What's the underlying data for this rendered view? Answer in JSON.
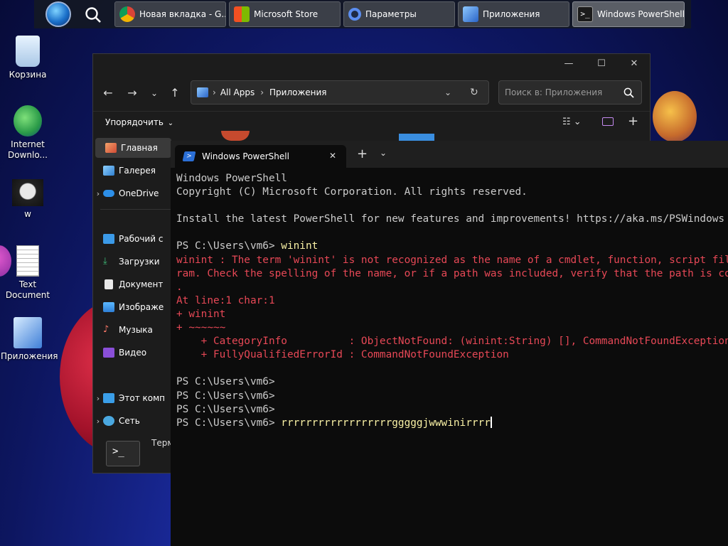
{
  "taskbar": {
    "items": [
      {
        "label": "Новая вкладка - G...",
        "icon": "chrome-icon"
      },
      {
        "label": "Microsoft Store",
        "icon": "store-icon"
      },
      {
        "label": "Параметры",
        "icon": "settings-icon"
      },
      {
        "label": "Приложения",
        "icon": "control-panel-icon"
      },
      {
        "label": "Windows PowerShell",
        "icon": "powershell-icon",
        "active": true
      }
    ]
  },
  "desktop": {
    "icons": [
      {
        "label": "Корзина",
        "icon": "recycle-bin-icon"
      },
      {
        "label": "Internet Downlo...",
        "icon": "idm-icon"
      },
      {
        "label": "w",
        "icon": "face-image-icon"
      },
      {
        "label": "Text Document",
        "icon": "text-document-icon"
      },
      {
        "label": "Приложения",
        "icon": "control-panel-icon"
      }
    ]
  },
  "explorer": {
    "breadcrumb": [
      "All Apps",
      "Приложения"
    ],
    "search_placeholder": "Поиск в: Приложения",
    "sort_label": "Упорядочить",
    "sidebar": [
      {
        "label": "Главная",
        "icon": "home-icon",
        "selected": true
      },
      {
        "label": "Галерея",
        "icon": "gallery-icon"
      },
      {
        "label": "OneDrive",
        "icon": "cloud-icon",
        "expandable": true
      },
      {
        "label": "Рабочий с",
        "icon": "desktop-icon"
      },
      {
        "label": "Загрузки",
        "icon": "download-icon"
      },
      {
        "label": "Документ",
        "icon": "document-icon"
      },
      {
        "label": "Изображе",
        "icon": "image-icon"
      },
      {
        "label": "Музыка",
        "icon": "music-icon"
      },
      {
        "label": "Видео",
        "icon": "video-icon"
      },
      {
        "label": "Этот комп",
        "icon": "computer-icon",
        "expandable": true
      },
      {
        "label": "Сеть",
        "icon": "network-icon",
        "expandable": true
      }
    ],
    "bottom_item": "Терм"
  },
  "powershell": {
    "tab_title": "Windows PowerShell",
    "lines": [
      {
        "text": "Windows PowerShell",
        "style": "normal"
      },
      {
        "text": "Copyright (C) Microsoft Corporation. All rights reserved.",
        "style": "normal"
      },
      {
        "text": "",
        "style": "normal"
      },
      {
        "text": "Install the latest PowerShell for new features and improvements! https://aka.ms/PSWindows",
        "style": "normal"
      },
      {
        "text": "",
        "style": "normal"
      },
      {
        "prompt": "PS C:\\Users\\vm6> ",
        "command": "winint",
        "style": "prompt"
      },
      {
        "text": "winint : The term 'winint' is not recognized as the name of a cmdlet, function, script file, or operable prog",
        "style": "error"
      },
      {
        "text": "ram. Check the spelling of the name, or if a path was included, verify that the path is correct and try again.",
        "style": "error"
      },
      {
        "text": ".",
        "style": "error"
      },
      {
        "text": "At line:1 char:1",
        "style": "error"
      },
      {
        "text": "+ winint",
        "style": "error"
      },
      {
        "text": "+ ~~~~~~",
        "style": "error"
      },
      {
        "text": "    + CategoryInfo          : ObjectNotFound: (winint:String) [], CommandNotFoundException",
        "style": "error"
      },
      {
        "text": "    + FullyQualifiedErrorId : CommandNotFoundException",
        "style": "error"
      },
      {
        "text": "",
        "style": "normal"
      },
      {
        "prompt": "PS C:\\Users\\vm6>",
        "command": "",
        "style": "prompt"
      },
      {
        "prompt": "PS C:\\Users\\vm6>",
        "command": "",
        "style": "prompt"
      },
      {
        "prompt": "PS C:\\Users\\vm6>",
        "command": "",
        "style": "prompt"
      },
      {
        "prompt": "PS C:\\Users\\vm6> ",
        "command": "rrrrrrrrrrrrrrrrrrgggggjwwwinirrrr",
        "style": "prompt",
        "cursor": true
      }
    ]
  }
}
